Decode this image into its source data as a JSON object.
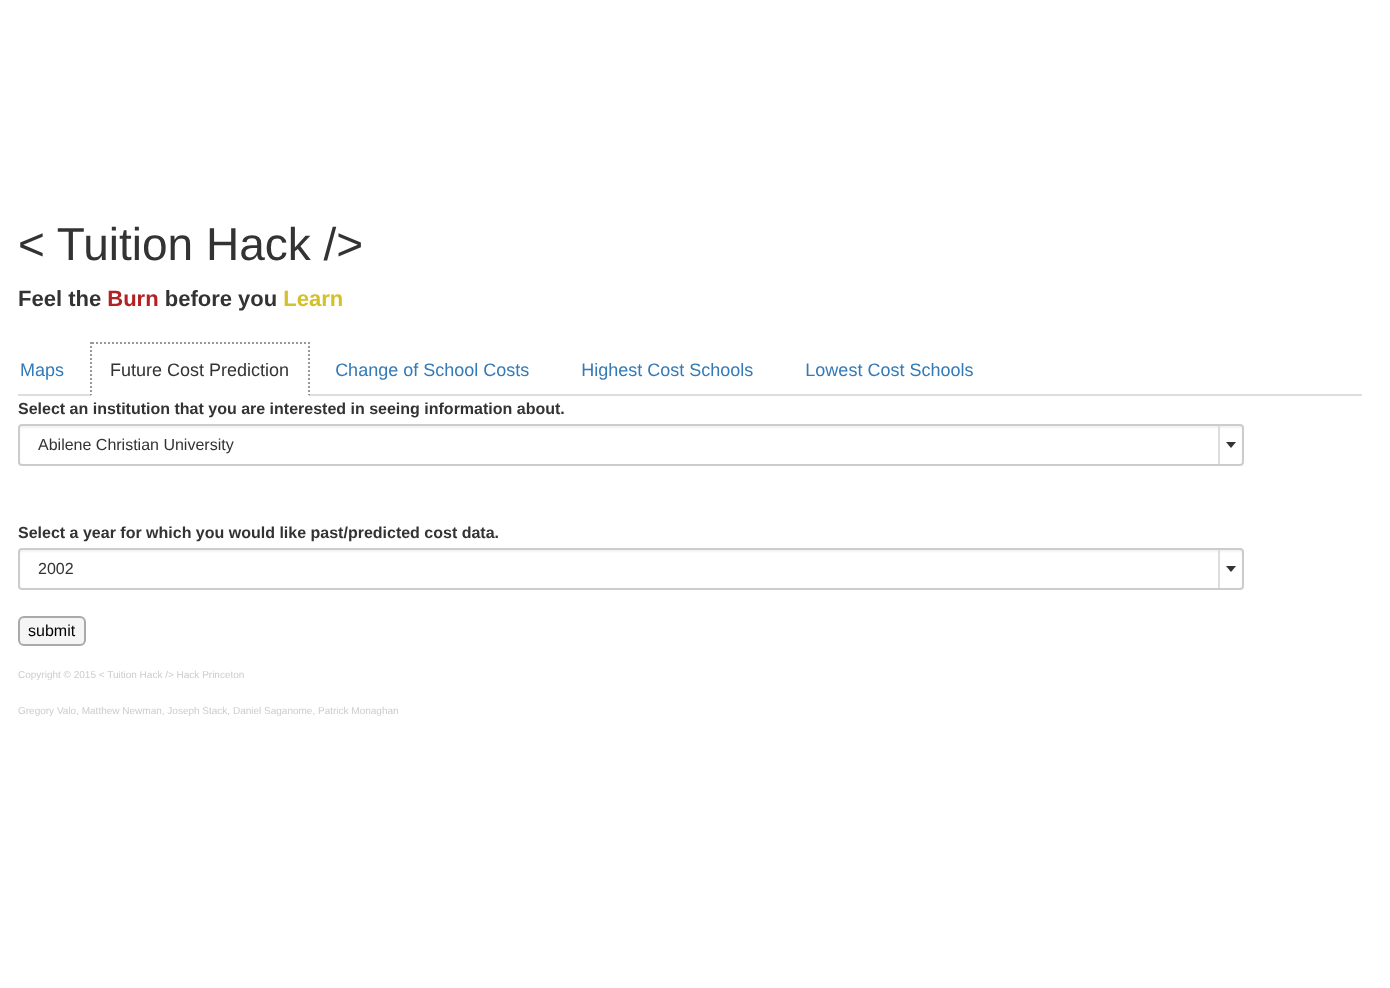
{
  "header": {
    "title": "< Tuition Hack />",
    "tagline": [
      {
        "text": "Feel the ",
        "color": "#333333"
      },
      {
        "text": "Burn",
        "color": "#b22222"
      },
      {
        "text": " before you ",
        "color": "#333333"
      },
      {
        "text": "Learn",
        "color": "#d4c12a"
      }
    ]
  },
  "tabs": [
    {
      "label": "Maps",
      "selected": false
    },
    {
      "label": "Future Cost Prediction",
      "selected": true
    },
    {
      "label": "Change of School Costs",
      "selected": false
    },
    {
      "label": "Highest Cost Schools",
      "selected": false
    },
    {
      "label": "Lowest Cost Schools",
      "selected": false
    }
  ],
  "form": {
    "fields": [
      {
        "label": "Select an institution that you are interested in seeing information about.",
        "value": "Abilene Christian University"
      },
      {
        "label": "Select a year for which you would like past/predicted cost data.",
        "value": "2002"
      }
    ],
    "submit": "submit"
  },
  "footer": {
    "copyright": "Copyright © 2015 < Tuition Hack /> Hack Princeton",
    "authors": "Gregory Valo, Matthew Newman, Joseph Stack, Daniel Saganome, Patrick Monaghan"
  }
}
